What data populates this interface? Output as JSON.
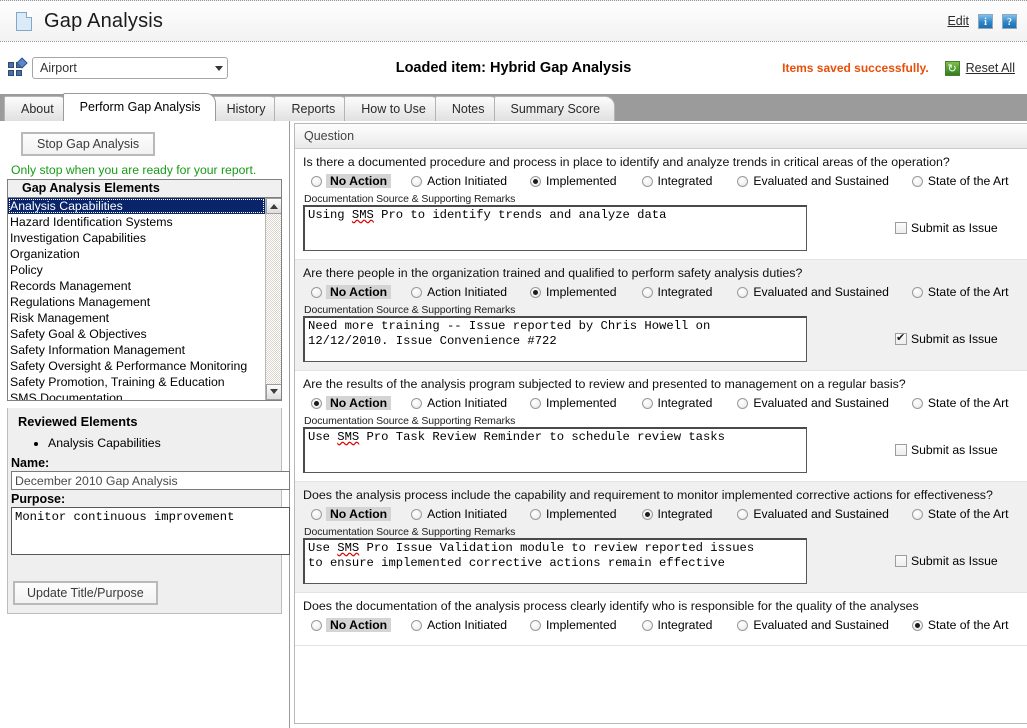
{
  "titlebar": {
    "app_title": "Gap Analysis",
    "doc_icon": "document-icon",
    "edit_label": "Edit",
    "info_icon_label": "i",
    "help_icon_label": "?"
  },
  "subheader": {
    "org_select_value": "Airport",
    "loaded_item": "Loaded item: Hybrid Gap Analysis",
    "saved_message": "Items saved successfully.",
    "reset_icon_label": "↻",
    "reset_label": "Reset All"
  },
  "tabs": [
    {
      "label": "About",
      "active": false
    },
    {
      "label": "Perform Gap Analysis",
      "active": true
    },
    {
      "label": "History",
      "active": false
    },
    {
      "label": "Reports",
      "active": false
    },
    {
      "label": "How to Use",
      "active": false
    },
    {
      "label": "Notes",
      "active": false
    },
    {
      "label": "Summary Score",
      "active": false
    }
  ],
  "sidebar": {
    "stop_button": "Stop Gap Analysis",
    "stop_note": "Only stop when you are ready for your report.",
    "elements_header": "Gap Analysis Elements",
    "elements": [
      "Analysis Capabilities",
      "Hazard Identification Systems",
      "Investigation Capabilities",
      "Organization",
      "Policy",
      "Records Management",
      "Regulations Management",
      "Risk Management",
      "Safety Goal & Objectives",
      "Safety Information Management",
      "Safety Oversight & Performance Monitoring",
      "Safety Promotion, Training & Education",
      "SMS Documentation"
    ],
    "selected_element": "Analysis Capabilities",
    "reviewed_title": "Reviewed Elements",
    "reviewed_items": [
      "Analysis Capabilities"
    ],
    "name_label": "Name:",
    "name_value": "December 2010 Gap Analysis",
    "purpose_label": "Purpose:",
    "purpose_value": "Monitor continuous improvement",
    "update_button": "Update Title/Purpose"
  },
  "question_panel": {
    "header": "Question",
    "remarks_label": "Documentation Source & Supporting Remarks",
    "issue_label": "Submit as Issue",
    "options": [
      "No Action",
      "Action Initiated",
      "Implemented",
      "Integrated",
      "Evaluated and Sustained",
      "State of the Art"
    ],
    "questions": [
      {
        "text": "Is there a documented procedure and process in place to identify and analyze trends in critical areas of the operation?",
        "selected": "Implemented",
        "remarks": "Using SMS Pro to identify trends and analyze data",
        "misspelled": "SMS",
        "submit_as_issue": false
      },
      {
        "text": "Are there people in the organization trained and qualified to perform safety analysis duties?",
        "selected": "Implemented",
        "remarks": "Need more training -- Issue reported by Chris Howell on\n12/12/2010. Issue Convenience #722",
        "misspelled": "",
        "submit_as_issue": true
      },
      {
        "text": "Are the results of the analysis program subjected to review and presented to management on a regular basis?",
        "selected": "No Action",
        "remarks": "Use SMS Pro Task Review Reminder to schedule review tasks",
        "misspelled": "SMS",
        "submit_as_issue": false
      },
      {
        "text": "Does the analysis process include the capability and requirement to monitor implemented corrective actions for effectiveness?",
        "selected": "Integrated",
        "remarks": "Use SMS Pro Issue Validation module to review reported issues\nto ensure implemented corrective actions remain effective",
        "misspelled": "SMS",
        "submit_as_issue": false
      },
      {
        "text": "Does the documentation of the analysis process clearly identify who is responsible for the quality of the analyses",
        "selected": "State of the Art",
        "remarks": "",
        "misspelled": "",
        "submit_as_issue": false
      }
    ]
  },
  "colors": {
    "accent_saved": "#e8500a",
    "note_green": "#169b16",
    "selection_blue": "#0a246a",
    "tabbar_gray": "#9b9b9b"
  }
}
